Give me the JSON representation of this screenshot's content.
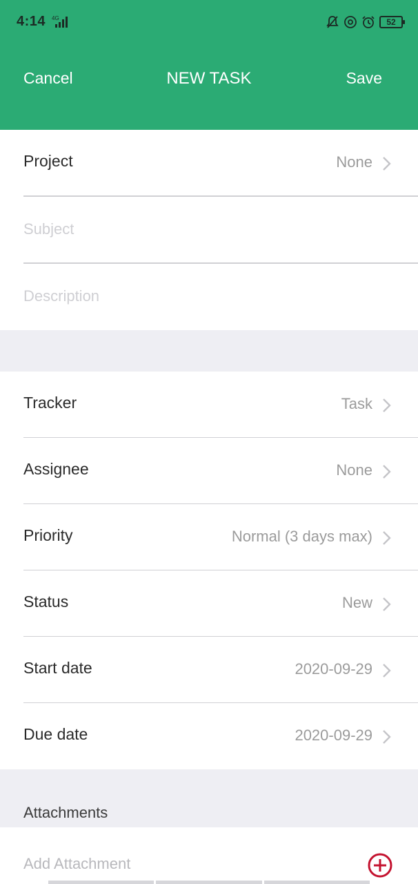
{
  "status_bar": {
    "time": "4:14",
    "network": "4G",
    "battery": "52"
  },
  "nav": {
    "cancel": "Cancel",
    "title": "NEW TASK",
    "save": "Save"
  },
  "form": {
    "project": {
      "label": "Project",
      "value": "None"
    },
    "subject_placeholder": "Subject",
    "description_placeholder": "Description",
    "tracker": {
      "label": "Tracker",
      "value": "Task"
    },
    "assignee": {
      "label": "Assignee",
      "value": "None"
    },
    "priority": {
      "label": "Priority",
      "value": "Normal (3 days max)"
    },
    "status": {
      "label": "Status",
      "value": "New"
    },
    "start_date": {
      "label": "Start date",
      "value": "2020-09-29"
    },
    "due_date": {
      "label": "Due date",
      "value": "2020-09-29"
    }
  },
  "attachments": {
    "header": "Attachments",
    "add_label": "Add Attachment"
  },
  "colors": {
    "accent": "#2bab74",
    "add_icon": "#c4122f"
  },
  "icons": {
    "chevron": "chevron-right-icon",
    "add": "plus-circle-icon"
  }
}
